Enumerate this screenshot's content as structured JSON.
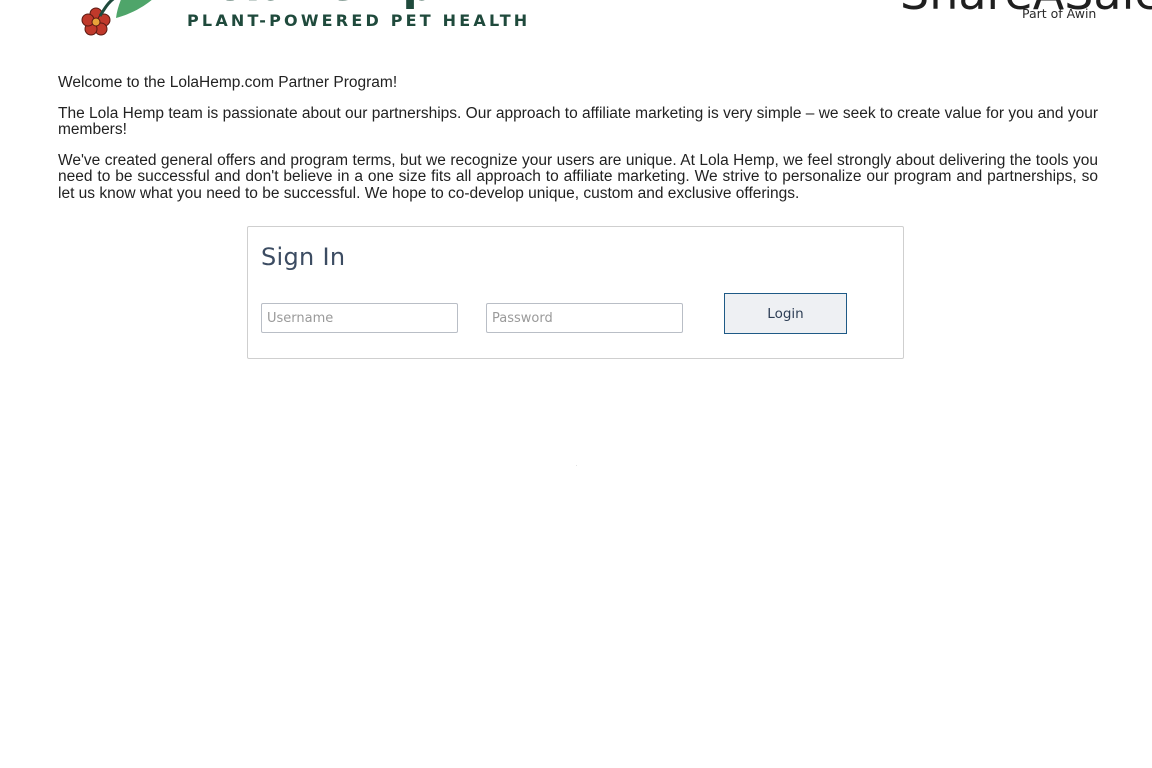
{
  "header": {
    "brand_name": "LolaHemp",
    "brand_tagline": "PLANT-POWERED PET HEALTH",
    "network_logo": "ShareASale",
    "network_sub": "Part of Awin",
    "colors": {
      "brand_green": "#1f4a3c",
      "leaf_green": "#4fa56a",
      "flower_red": "#c0392b"
    }
  },
  "intro": {
    "welcome": "Welcome to the LolaHemp.com Partner Program!",
    "paragraph_1": "The Lola Hemp team is passionate about our partnerships. Our approach to affiliate marketing is very simple – we seek to create value for you and your members!",
    "paragraph_2": "We've created general offers and program terms, but we recognize your users are unique. At Lola Hemp, we feel strongly about delivering the tools you need to be successful and don't believe in a one size fits all approach to affiliate marketing. We strive to personalize our program and partnerships, so let us know what you need to be successful. We hope to co-develop unique, custom and exclusive offerings."
  },
  "signin": {
    "title": "Sign In",
    "username_placeholder": "Username",
    "username_value": "",
    "password_placeholder": "Password",
    "password_value": "",
    "login_label": "Login",
    "colors": {
      "title": "#3c4c62",
      "button_border": "#1e5a86"
    }
  },
  "icons": {
    "brand_flower": "flower-icon",
    "brand_leaf": "leaf-icon"
  }
}
